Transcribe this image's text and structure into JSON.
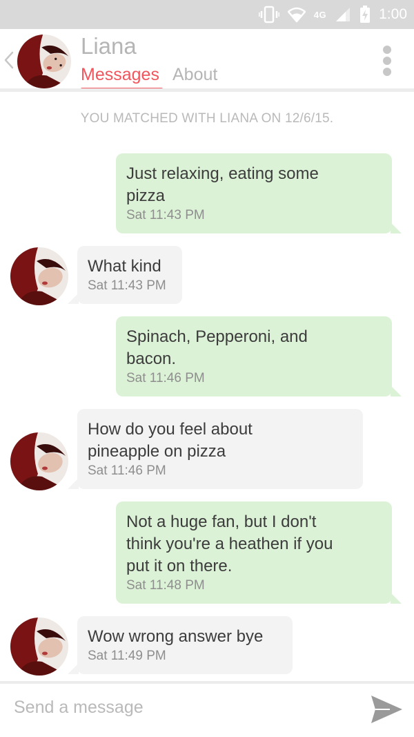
{
  "status_bar": {
    "network": "4G",
    "time": "1:00"
  },
  "header": {
    "contact_name": "Liana",
    "tabs": [
      {
        "label": "Messages",
        "active": true
      },
      {
        "label": "About",
        "active": false
      }
    ]
  },
  "chat": {
    "match_note": "YOU MATCHED WITH LIANA ON 12/6/15.",
    "messages": [
      {
        "from": "me",
        "lines": [
          "Just relaxing, eating some",
          "pizza"
        ],
        "time": "Sat 11:43 PM"
      },
      {
        "from": "them",
        "lines": [
          "What kind"
        ],
        "time": "Sat 11:43 PM"
      },
      {
        "from": "me",
        "lines": [
          "Spinach, Pepperoni, and",
          "bacon."
        ],
        "time": "Sat 11:46 PM"
      },
      {
        "from": "them",
        "lines": [
          "How do you feel about",
          "pineapple on pizza"
        ],
        "time": "Sat 11:46 PM"
      },
      {
        "from": "me",
        "lines": [
          "Not a huge fan, but I don't",
          "think you're a heathen if you",
          "put it on there."
        ],
        "time": "Sat 11:48 PM"
      },
      {
        "from": "them",
        "lines": [
          "Wow wrong answer bye"
        ],
        "time": "Sat 11:49 PM"
      }
    ]
  },
  "composer": {
    "placeholder": "Send a message"
  },
  "colors": {
    "accent": "#f0565d",
    "sent_bubble": "#dcf2d6",
    "received_bubble": "#f3f3f3",
    "status_bar": "#d9d9d9"
  },
  "icons": {
    "status": [
      "vibrate-icon",
      "wifi-icon",
      "signal-icon",
      "battery-charging-icon"
    ],
    "header": [
      "back-chevron-icon",
      "more-vertical-icon"
    ],
    "composer": [
      "send-icon"
    ]
  }
}
